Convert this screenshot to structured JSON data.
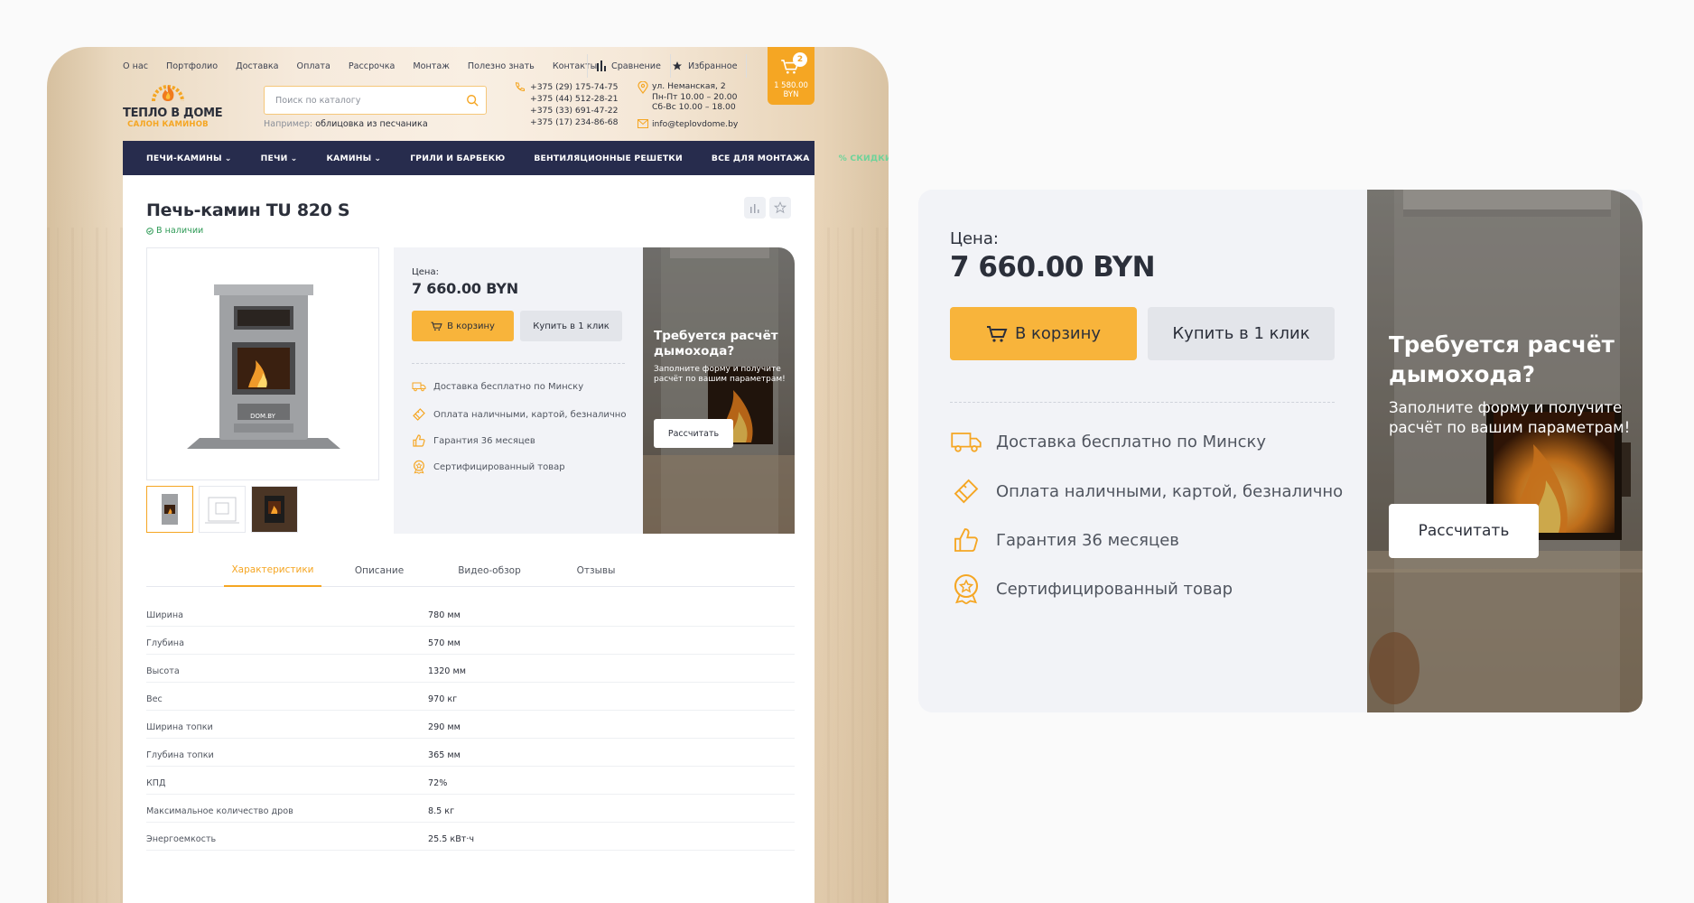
{
  "header": {
    "top_links": [
      "О нас",
      "Портфолио",
      "Доставка",
      "Оплата",
      "Рассрочка",
      "Монтаж",
      "Полезно знать",
      "Контакты"
    ],
    "compare_label": "Сравнение",
    "favorites_label": "Избранное",
    "cart": {
      "count": "2",
      "total": "1 580.00",
      "currency": "BYN"
    },
    "logo": {
      "title": "ТЕПЛО В ДОМЕ",
      "subtitle": "САЛОН КАМИНОВ"
    },
    "search": {
      "placeholder": "Поиск по каталогу",
      "example_prefix": "Например:",
      "example_value": "облицовка из песчаника"
    },
    "phones": [
      "+375 (29) 175-74-75",
      "+375 (44) 512-28-21",
      "+375 (33) 691-47-22",
      "+375 (17) 234-86-68"
    ],
    "address": [
      "ул. Неманская, 2",
      "Пн-Пт 10.00 – 20.00",
      "Сб-Вс 10.00 – 18.00"
    ],
    "email": "info@teplovdome.by",
    "main_nav": [
      "ПЕЧИ-КАМИНЫ",
      "ПЕЧИ",
      "КАМИНЫ",
      "ГРИЛИ И БАРБЕКЮ",
      "ВЕНТИЛЯЦИОННЫЕ РЕШЕТКИ",
      "ВСЕ ДЛЯ МОНТАЖА",
      "% СКИДКИ"
    ]
  },
  "product": {
    "title": "Печь-камин TU 820 S",
    "stock": "В наличии",
    "price_label": "Цена:",
    "price": "7 660.00 BYN",
    "add_to_cart": "В корзину",
    "buy_one_click": "Купить в 1 клик",
    "features": [
      "Доставка бесплатно по Минску",
      "Оплата наличными, картой, безналично",
      "Гарантия 36 месяцев",
      "Сертифицированный товар"
    ],
    "image_caption": "DOM.BY"
  },
  "promo": {
    "heading": "Требуется расчёт дымохода?",
    "text": "Заполните форму и получите расчёт по вашим параметрам!",
    "button": "Рассчитать"
  },
  "tabs": [
    "Характеристики",
    "Описание",
    "Видео-обзор",
    "Отзывы"
  ],
  "specs": [
    {
      "k": "Ширина",
      "v": "780 мм"
    },
    {
      "k": "Глубина",
      "v": "570 мм"
    },
    {
      "k": "Высота",
      "v": "1320 мм"
    },
    {
      "k": "Вес",
      "v": "970 кг"
    },
    {
      "k": "Ширина топки",
      "v": "290 мм"
    },
    {
      "k": "Глубина топки",
      "v": "365 мм"
    },
    {
      "k": "КПД",
      "v": "72%"
    },
    {
      "k": "Максимальное количество дров",
      "v": "8.5 кг"
    },
    {
      "k": "Энергоемкость",
      "v": "25.5 кВт·ч"
    }
  ],
  "colors": {
    "accent": "#f5a623",
    "nav": "#272c4d",
    "sale": "#6ed39a",
    "panel": "#f2f3f7"
  }
}
